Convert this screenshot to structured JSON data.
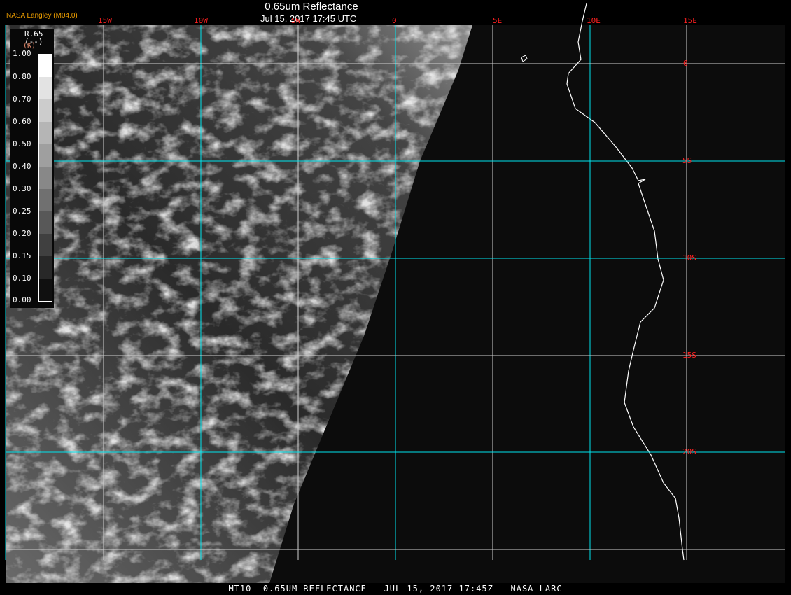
{
  "header": {
    "title": "0.65um Reflectance",
    "subtitle": "Jul 15, 2017 17:45 UTC",
    "brand": "NASA Langley (M04.0)"
  },
  "lon_labels": [
    "15W",
    "10W",
    "5W",
    "0",
    "5E",
    "10E",
    "15E"
  ],
  "lat_labels": [
    "0",
    "5S",
    "10S",
    "15S",
    "20S"
  ],
  "legend": {
    "name": "R.65",
    "unit": "(--)",
    "unit2": "(K)",
    "ticks": [
      "1.00",
      "0.80",
      "0.70",
      "0.60",
      "0.50",
      "0.40",
      "0.30",
      "0.25",
      "0.20",
      "0.15",
      "0.10",
      "0.00"
    ]
  },
  "footer": "MT10  0.65UM REFLECTANCE   JUL 15, 2017 17:45Z   NASA LARC",
  "colors": {
    "grid": "#00e5ee",
    "label": "#ff2020",
    "brand": "#f0a000",
    "coast": "#ffffff"
  }
}
